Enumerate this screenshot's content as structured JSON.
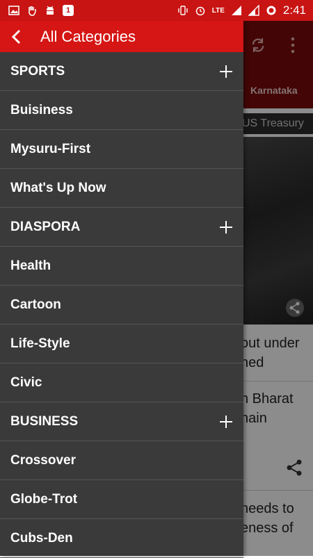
{
  "status_bar": {
    "network": "LTE",
    "time": "2:41",
    "notification_count": "1"
  },
  "app_background": {
    "tab_label": "Karnataka",
    "ticker_text": "US Treasury",
    "headline_1_line_1": "out under",
    "headline_1_line_2": "hed",
    "headline_2_line_1": "n Bharat",
    "headline_2_line_2": "nain",
    "headline_3_line_1": "needs to",
    "headline_3_line_2": "eness of"
  },
  "drawer": {
    "title": "All Categories",
    "items": [
      {
        "label": "SPORTS",
        "expandable": true
      },
      {
        "label": "Buisiness",
        "expandable": false
      },
      {
        "label": "Mysuru-First",
        "expandable": false
      },
      {
        "label": "What's Up Now",
        "expandable": false
      },
      {
        "label": "DIASPORA",
        "expandable": true
      },
      {
        "label": "Health",
        "expandable": false
      },
      {
        "label": "Cartoon",
        "expandable": false
      },
      {
        "label": "Life-Style",
        "expandable": false
      },
      {
        "label": "Civic",
        "expandable": false
      },
      {
        "label": "BUSINESS",
        "expandable": true
      },
      {
        "label": "Crossover",
        "expandable": false
      },
      {
        "label": "Globe-Trot",
        "expandable": false
      },
      {
        "label": "Cubs-Den",
        "expandable": false
      }
    ]
  },
  "colors": {
    "status_bar": "#c81413",
    "drawer_header": "#d51614",
    "drawer_bg": "#3a3a3a"
  }
}
